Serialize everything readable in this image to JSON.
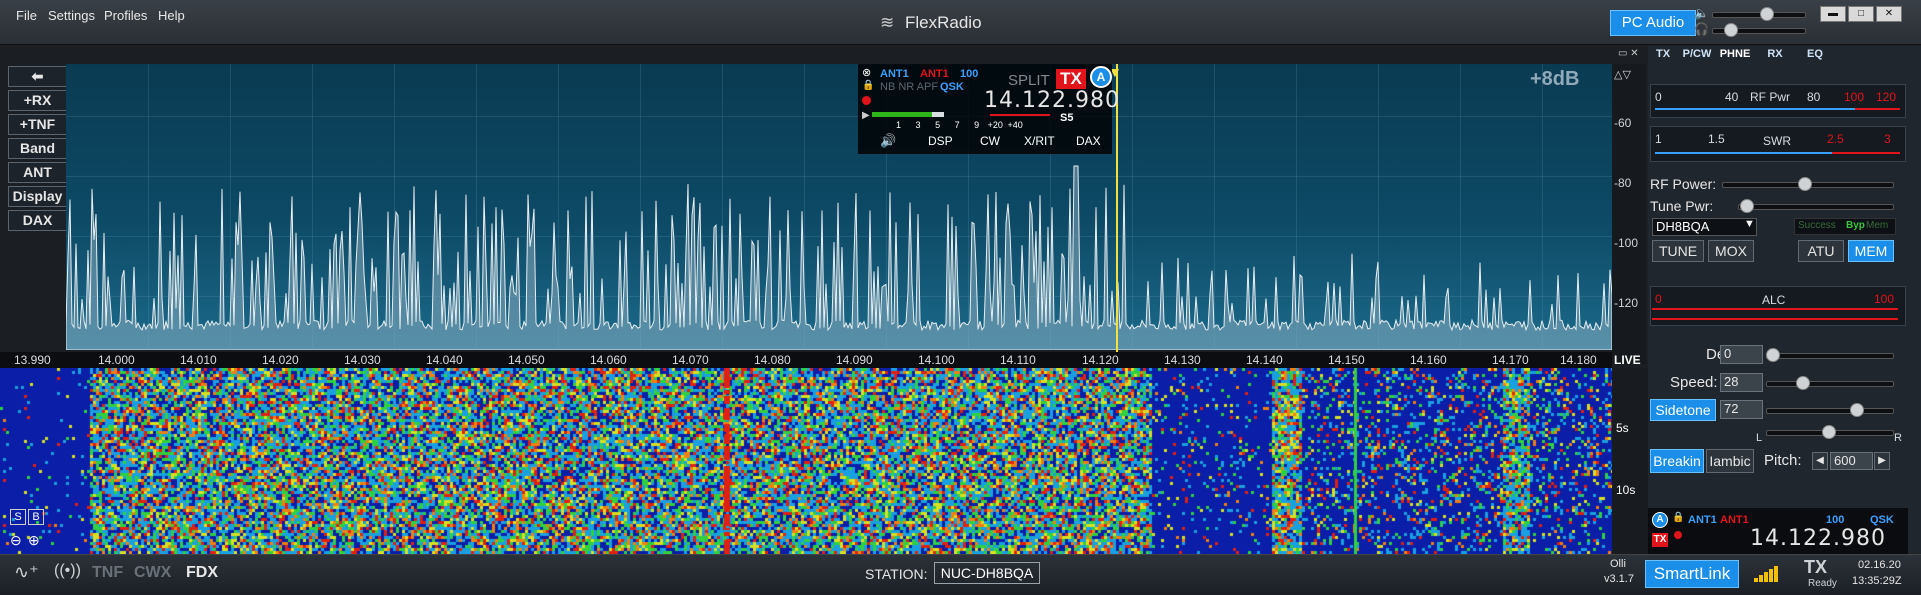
{
  "menu": {
    "file": "File",
    "settings": "Settings",
    "profiles": "Profiles",
    "help": "Help"
  },
  "app_title": "FlexRadio",
  "pc_audio": "PC Audio",
  "window_controls": {
    "minimize": "▬",
    "maximize": "□",
    "close": "✕"
  },
  "left_buttons": {
    "back": "⬅",
    "rx": "+RX",
    "tnf": "+TNF",
    "band": "Band",
    "ant": "ANT",
    "display": "Display",
    "dax": "DAX"
  },
  "pan": {
    "gain_label": "+8dB",
    "db_ticks": [
      "-60",
      "-80",
      "-100",
      "-120"
    ],
    "freq_ticks": [
      "13.990",
      "14.000",
      "14.010",
      "14.020",
      "14.030",
      "14.040",
      "14.050",
      "14.060",
      "14.070",
      "14.080",
      "14.090",
      "14.100",
      "14.110",
      "14.120",
      "14.130",
      "14.140",
      "14.150",
      "14.160",
      "14.170",
      "14.180"
    ],
    "live": "LIVE",
    "time_marks": [
      "5s",
      "10s"
    ]
  },
  "slice": {
    "rx_ant": "ANT1",
    "tx_ant": "ANT1",
    "power": "100",
    "qsk": "QSK",
    "modes": "NB NR APF",
    "split": "SPLIT",
    "tx": "TX",
    "letter": "A",
    "frequency": "14.122.980",
    "smeter_scale": [
      "1",
      "3",
      "5",
      "7",
      "9",
      "+20",
      "+40"
    ],
    "smeter_reading": "S5",
    "tabs": [
      "DSP",
      "CW",
      "X/RIT",
      "DAX"
    ]
  },
  "right_panel": {
    "tabs": [
      "TX",
      "P/CW",
      "PHNE",
      "RX",
      "EQ"
    ],
    "rfpwr_meter": {
      "label": "RF Pwr",
      "ticks": [
        "0",
        "40",
        "80",
        "100",
        "120"
      ]
    },
    "swr_meter": {
      "label": "SWR",
      "ticks": [
        "1",
        "1.5",
        "2.5",
        "3"
      ]
    },
    "rf_power_label": "RF Power:",
    "tune_pwr_label": "Tune Pwr:",
    "profile": "DH8BQA",
    "atu_status": {
      "success": "Success",
      "byp": "Byp",
      "mem": "Mem"
    },
    "buttons": {
      "tune": "TUNE",
      "mox": "MOX",
      "atu": "ATU",
      "mem": "MEM"
    },
    "alc": {
      "label": "ALC",
      "min": "0",
      "max": "100"
    },
    "cw": {
      "delay_label": "Delay:",
      "delay_value": "0",
      "speed_label": "Speed:",
      "speed_value": "28",
      "sidetone_label": "Sidetone",
      "sidetone_value": "72",
      "pan_l": "L",
      "pan_r": "R",
      "breakin": "Breakin",
      "iambic": "Iambic",
      "pitch_label": "Pitch:",
      "pitch_value": "600"
    },
    "mini_slice": {
      "letter": "A",
      "rx_ant": "ANT1",
      "tx_ant": "ANT1",
      "power": "100",
      "qsk": "QSK",
      "tx": "TX",
      "frequency": "14.122.980"
    }
  },
  "status": {
    "tnf": "TNF",
    "cwx": "CWX",
    "fdx": "FDX",
    "station_label": "STATION:",
    "station_value": "NUC-DH8BQA",
    "user": "Olli",
    "version": "v3.1.7",
    "smartlink": "SmartLink",
    "tx": "TX",
    "tx_state": "Ready",
    "date": "02.16.20",
    "time": "13:35:29Z"
  },
  "colors": {
    "accent": "#1a8ee8",
    "tx_red": "#e0141a",
    "spectrum": "#e8eef2",
    "tuning_line": "#f0e040"
  }
}
